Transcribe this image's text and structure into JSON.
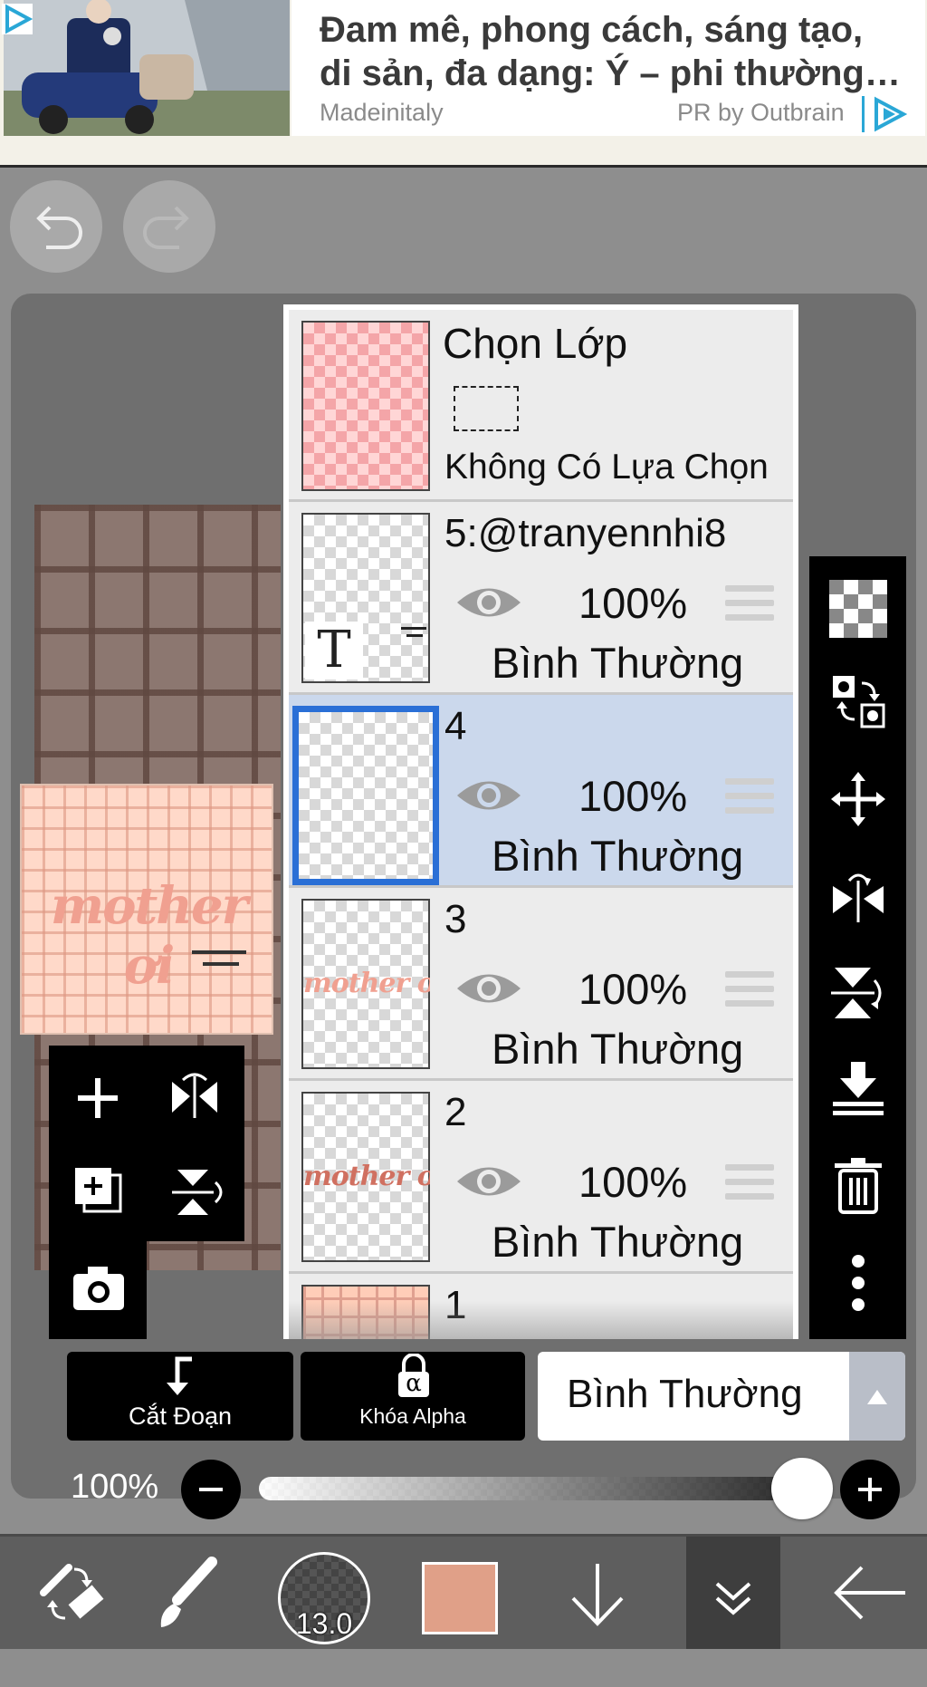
{
  "ad": {
    "title_line1": "Đam mê, phong cách, sáng tạo,",
    "title_line2": "di sản, đa dạng: Ý – phi thường…",
    "source": "Madeinitaly",
    "sponsor": "PR by Outbrain",
    "ad_icon": "play-triangle-icon"
  },
  "history": {
    "undo_icon": "undo-icon",
    "redo_icon": "redo-icon"
  },
  "selection_layer": {
    "title": "Chọn Lớp",
    "status": "Không Có Lựa Chọn"
  },
  "layers": [
    {
      "number": "5:@tranyennhi8",
      "opacity": "100%",
      "mode": "Bình Thường",
      "type": "text",
      "selected": false
    },
    {
      "number": "4",
      "opacity": "100%",
      "mode": "Bình Thường",
      "type": "raster",
      "selected": true
    },
    {
      "number": "3",
      "opacity": "100%",
      "mode": "Bình Thường",
      "type": "raster",
      "selected": false
    },
    {
      "number": "2",
      "opacity": "100%",
      "mode": "Bình Thường",
      "type": "raster",
      "selected": false
    },
    {
      "number": "1",
      "type": "raster",
      "selected": false
    }
  ],
  "layer_thumb_text": {
    "text_layer_glyph": "T",
    "art_text": "mother ơi"
  },
  "preview": {
    "art_text": "mother ơi"
  },
  "controls": {
    "clipping_label": "Cắt Đoạn",
    "alpha_lock_label": "Khóa Alpha",
    "alpha_symbol": "α",
    "blend_mode": "Bình Thường",
    "opacity_label": "100%",
    "opacity_value": 1.0
  },
  "toolbar": {
    "brush_size": "13.0",
    "current_color": "#e0a088"
  },
  "colors": {
    "selected_layer": "#cbd8ec",
    "selected_border": "#2a6fd6",
    "accent_blue": "#2aa7d6"
  }
}
